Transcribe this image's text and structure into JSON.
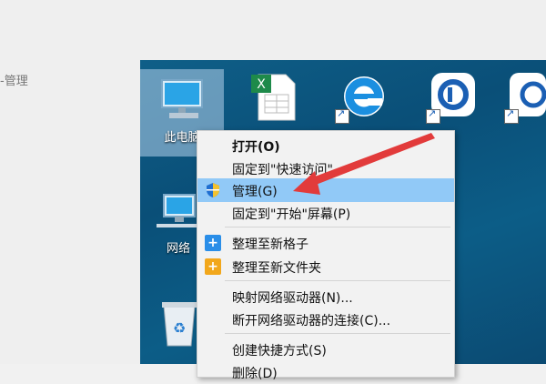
{
  "background": {
    "partial_text": "-管理"
  },
  "desktop": {
    "icons": [
      {
        "label": "此电脑"
      },
      {
        "label": "网络"
      }
    ]
  },
  "context_menu": {
    "items": [
      "打开(O)",
      "固定到\"快速访问\"",
      "管理(G)",
      "固定到\"开始\"屏幕(P)",
      "整理至新格子",
      "整理至新文件夹",
      "映射网络驱动器(N)...",
      "断开网络驱动器的连接(C)...",
      "创建快捷方式(S)",
      "删除(D)"
    ],
    "highlighted": "管理(G)"
  },
  "colors": {
    "highlight": "#91c9f7",
    "arrow": "#e23b3b",
    "desktop_blue": "#0c5d87"
  }
}
